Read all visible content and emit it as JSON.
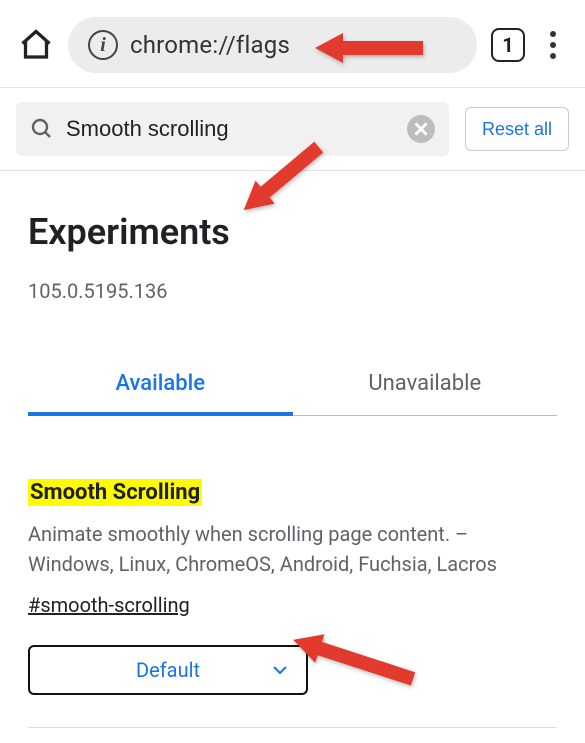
{
  "topbar": {
    "url": "chrome://flags",
    "tab_count": "1"
  },
  "search": {
    "value": "Smooth scrolling",
    "reset_label": "Reset all"
  },
  "page": {
    "title": "Experiments",
    "version": "105.0.5195.136"
  },
  "tabs": {
    "available": "Available",
    "unavailable": "Unavailable"
  },
  "flag": {
    "title": "Smooth Scrolling",
    "desc": "Animate smoothly when scrolling page content. – Windows, Linux, ChromeOS, Android, Fuchsia, Lacros",
    "hash": "#smooth-scrolling",
    "select_value": "Default"
  }
}
